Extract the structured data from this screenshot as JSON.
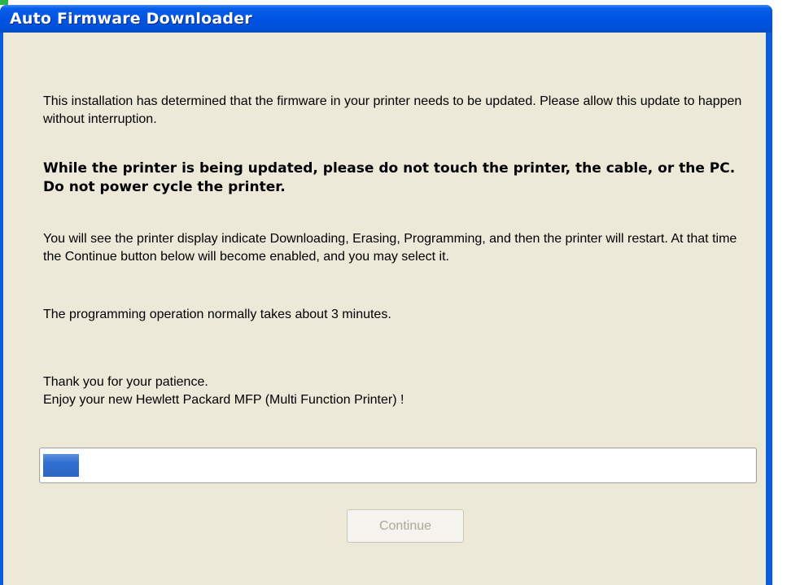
{
  "window": {
    "title": "Auto Firmware Downloader"
  },
  "content": {
    "intro": "This installation has determined that the firmware in your printer needs to be updated.  Please allow this update to happen without interruption.",
    "warning": "While the printer is being updated, please do not touch the printer, the cable, or the PC.  Do not power cycle the printer.",
    "instructions": "You  will see the printer display indicate Downloading, Erasing, Programming, and then the printer will restart.  At that time the Continue button below will become enabled, and you may select it.",
    "duration": "The programming operation normally takes about 3 minutes.",
    "thanks_line1": "Thank you for your patience.",
    "thanks_line2": "Enjoy your new Hewlett Packard MFP (Multi Function Printer) !"
  },
  "progress": {
    "fraction": 0.05,
    "color": "#2f6fd0"
  },
  "buttons": {
    "continue_label": "Continue",
    "continue_enabled": false
  },
  "colors": {
    "titlebar": "#0054e3",
    "client_bg": "#ece9d8",
    "accent_strip": "#2bb34a"
  }
}
